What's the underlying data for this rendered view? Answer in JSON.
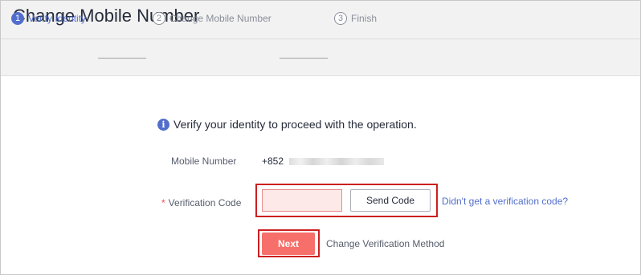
{
  "page": {
    "title": "Change Mobile Number"
  },
  "steps": [
    {
      "number": "1",
      "label": "Verify Identity",
      "state": "active"
    },
    {
      "number": "2",
      "label": "Change Mobile Number",
      "state": "inactive"
    },
    {
      "number": "3",
      "label": "Finish",
      "state": "inactive"
    }
  ],
  "notice": {
    "icon": "info-icon",
    "text": "Verify your identity to proceed with the operation."
  },
  "form": {
    "mobile_label": "Mobile Number",
    "mobile_prefix": "+852",
    "required_marker": "*",
    "code_label": "Verification Code",
    "code_value": "",
    "send_code_label": "Send Code",
    "no_code_link": "Didn't get a verification code?",
    "next_label": "Next",
    "change_method_label": "Change Verification Method"
  },
  "colors": {
    "accent": "#526ecc",
    "primary_button": "#f66f6a",
    "highlight_border": "#cc1f1f",
    "required": "#f24e4e"
  }
}
